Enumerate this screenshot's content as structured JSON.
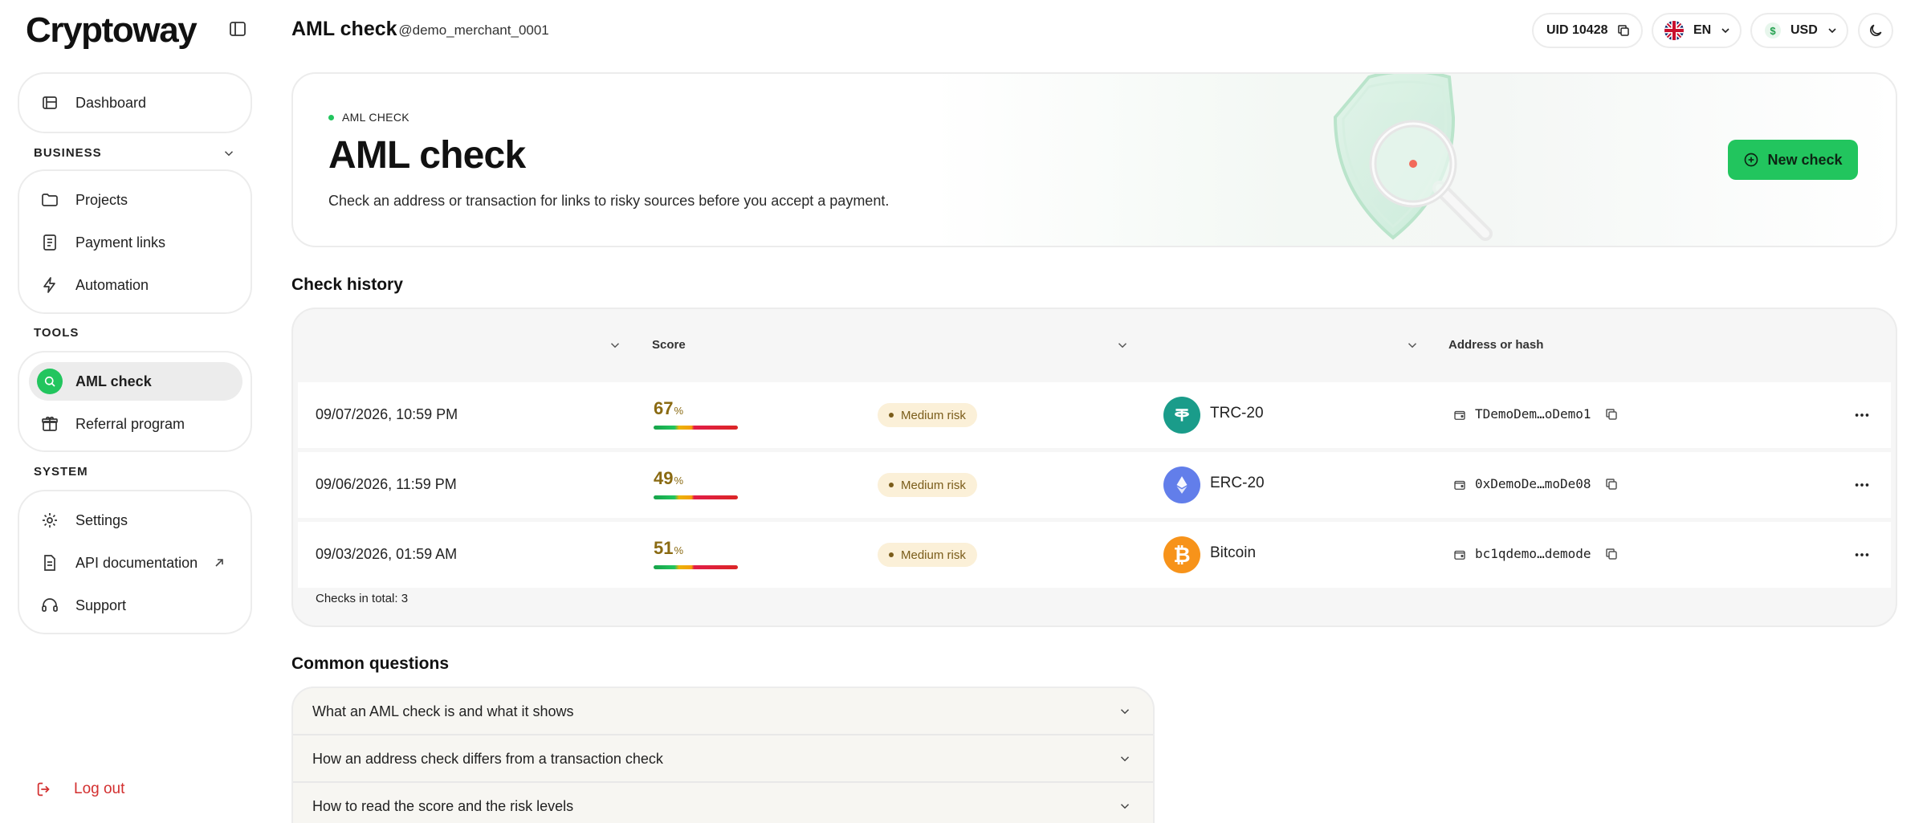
{
  "app": {
    "logo_text": "Cryptoway"
  },
  "header": {
    "title": "AML check",
    "subtitle": "· @demo_merchant_0001",
    "uid_label": "UID 10428",
    "language": "EN",
    "currency": "USD"
  },
  "sidebar": {
    "dashboard": "Dashboard",
    "business_title": "BUSINESS",
    "business_items": [
      "Projects",
      "Payment links",
      "Automation"
    ],
    "tools_title": "TOOLS",
    "tools_items": [
      "AML check",
      "Referral program"
    ],
    "system_title": "SYSTEM",
    "system_items": [
      "Settings",
      "API documentation",
      "Support"
    ],
    "logout": "Log out"
  },
  "hero": {
    "tag": "AML CHECK",
    "title": "AML check",
    "description": "Check an address or transaction for links to risky sources before you accept a payment.",
    "button": "New check"
  },
  "history": {
    "title": "Check history",
    "columns": {
      "score": "Score",
      "address": "Address or hash"
    },
    "rows": [
      {
        "date": "09/07/2026, 10:59 PM",
        "score": "67",
        "risk": "Medium risk",
        "network": "TRC-20",
        "address": "TDemoDem…oDemo1"
      },
      {
        "date": "09/06/2026, 11:59 PM",
        "score": "49",
        "risk": "Medium risk",
        "network": "ERC-20",
        "address": "0xDemoDe…moDe08"
      },
      {
        "date": "09/03/2026, 01:59 AM",
        "score": "51",
        "risk": "Medium risk",
        "network": "Bitcoin",
        "address": "bc1qdemo…demode"
      }
    ],
    "pct_sign": "%",
    "total": "Checks in total: 3"
  },
  "faq": {
    "title": "Common questions",
    "items": [
      "What an AML check is and what it shows",
      "How an address check differs from a transaction check",
      "How to read the score and the risk levels"
    ]
  },
  "colors": {
    "accent": "#22c55e",
    "risk_text": "#7a5c1a",
    "risk_bg": "#fbf0d8",
    "logout": "#d32f2f",
    "trc20": "#1a9c8a",
    "erc20": "#627eea",
    "bitcoin": "#f7931a"
  }
}
